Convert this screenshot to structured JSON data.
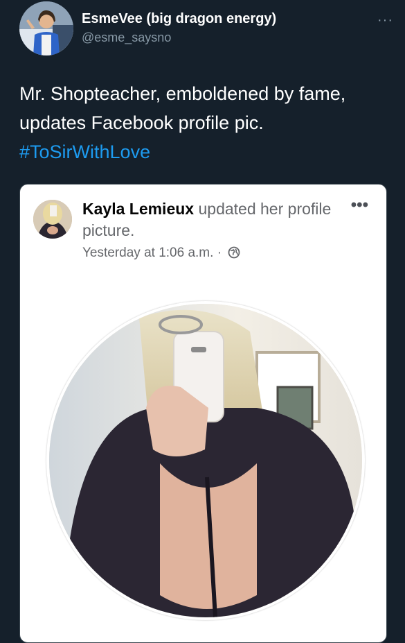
{
  "tweet": {
    "author": {
      "display_name": "EsmeVee (big dragon energy)",
      "handle": "@esme_saysno"
    },
    "more_icon": "more-horizontal-icon",
    "text": "Mr. Shopteacher, emboldened by fame, updates Facebook profile pic.",
    "hashtag": "#ToSirWithLove"
  },
  "facebook_post": {
    "author_name": "Kayla Lemieux",
    "action_text": "updated her profile picture.",
    "timestamp": "Yesterday at 1:06 a.m. ·",
    "privacy_icon": "globe-icon",
    "more_icon": "more-horizontal-icon"
  },
  "colors": {
    "background": "#15202b",
    "hashtag": "#1d9bf0",
    "secondary_text": "#8899a6"
  }
}
